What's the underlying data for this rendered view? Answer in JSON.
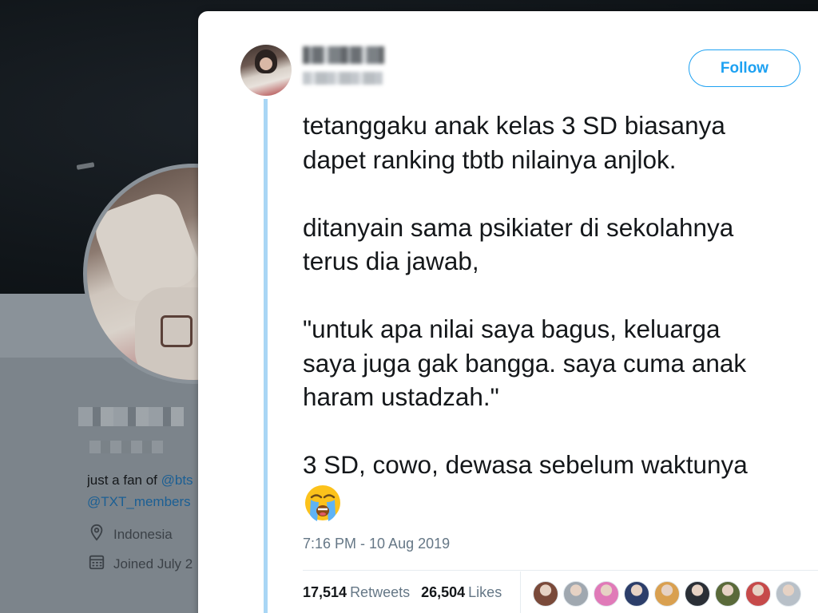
{
  "profile": {
    "bio_prefix": "just a fan of ",
    "bio_mention_1": "@bts",
    "bio_mention_2": "@TXT_members",
    "location": "Indonesia",
    "joined": "Joined July 2"
  },
  "tweet": {
    "follow_label": "Follow",
    "text": "tetanggaku anak kelas 3 SD biasanya\ndapet ranking tbtb nilainya anjlok.\n\nditanyain sama psikiater di sekolahnya\nterus dia jawab,\n\n\"untuk apa nilai saya bagus, keluarga\nsaya juga gak bangga. saya cuma anak\nharam ustadzah.\"\n\n3 SD, cowo, dewasa sebelum waktunya",
    "emoji": "crying-face",
    "timestamp": "7:16 PM - 10 Aug 2019",
    "retweets_count": "17,514",
    "retweets_label": "Retweets",
    "likes_count": "26,504",
    "likes_label": "Likes"
  },
  "likers": [
    {
      "color": "#7a4a3a"
    },
    {
      "color": "#a0a8b0"
    },
    {
      "color": "#e07ab8"
    },
    {
      "color": "#2c3e6a"
    },
    {
      "color": "#d9a050"
    },
    {
      "color": "#2a2f36"
    },
    {
      "color": "#5a6a3a"
    },
    {
      "color": "#c64a4a"
    },
    {
      "color": "#b8c0c8"
    }
  ],
  "colors": {
    "accent": "#1da1f2",
    "thread_line": "#a9d6f5",
    "muted": "#657786"
  }
}
